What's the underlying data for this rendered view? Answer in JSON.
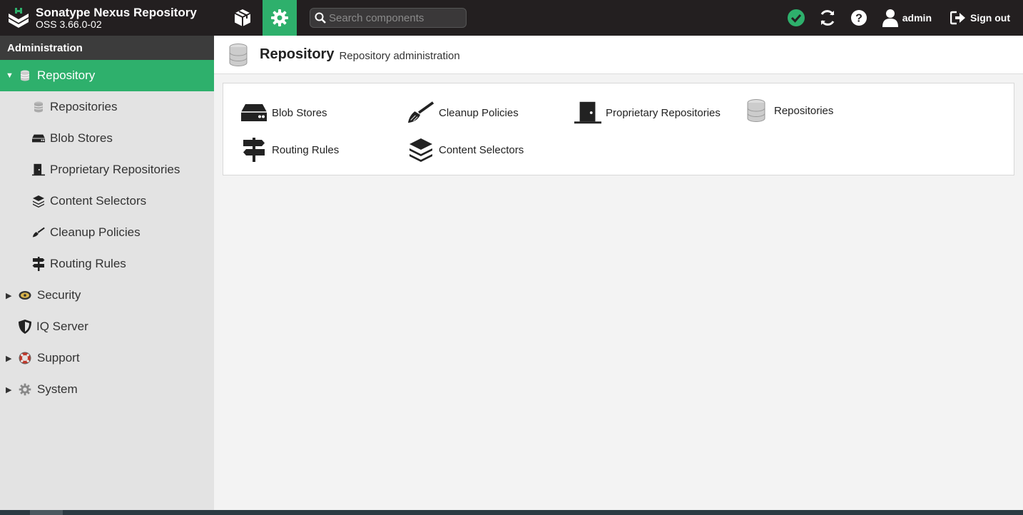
{
  "app": {
    "name": "Sonatype Nexus Repository",
    "version": "OSS 3.66.0-02"
  },
  "header": {
    "search_placeholder": "Search components",
    "user": "admin",
    "signout_label": "Sign out",
    "status_color": "#2eb06c"
  },
  "sidebar": {
    "title": "Administration",
    "items": [
      {
        "label": "Repository",
        "icon": "database-icon",
        "expanded": true,
        "selected": true
      },
      {
        "label": "Repositories",
        "icon": "database-icon"
      },
      {
        "label": "Blob Stores",
        "icon": "hdd-icon"
      },
      {
        "label": "Proprietary Repositories",
        "icon": "door-icon"
      },
      {
        "label": "Content Selectors",
        "icon": "layers-icon"
      },
      {
        "label": "Cleanup Policies",
        "icon": "broom-icon"
      },
      {
        "label": "Routing Rules",
        "icon": "signpost-icon"
      },
      {
        "label": "Security",
        "icon": "badge-icon"
      },
      {
        "label": "IQ Server",
        "icon": "shield-icon"
      },
      {
        "label": "Support",
        "icon": "lifebuoy-icon"
      },
      {
        "label": "System",
        "icon": "gear-icon"
      }
    ]
  },
  "content": {
    "title": "Repository",
    "subtitle": "Repository administration",
    "tiles": [
      {
        "label": "Blob Stores",
        "icon": "hdd-icon"
      },
      {
        "label": "Cleanup Policies",
        "icon": "broom-icon"
      },
      {
        "label": "Proprietary Repositories",
        "icon": "door-icon"
      },
      {
        "label": "Repositories",
        "icon": "database-icon"
      },
      {
        "label": "Routing Rules",
        "icon": "signpost-icon"
      },
      {
        "label": "Content Selectors",
        "icon": "layers-icon"
      }
    ]
  },
  "colors": {
    "accent": "#2eb06c",
    "topbar": "#231f20",
    "sidebar": "#e3e3e3"
  }
}
